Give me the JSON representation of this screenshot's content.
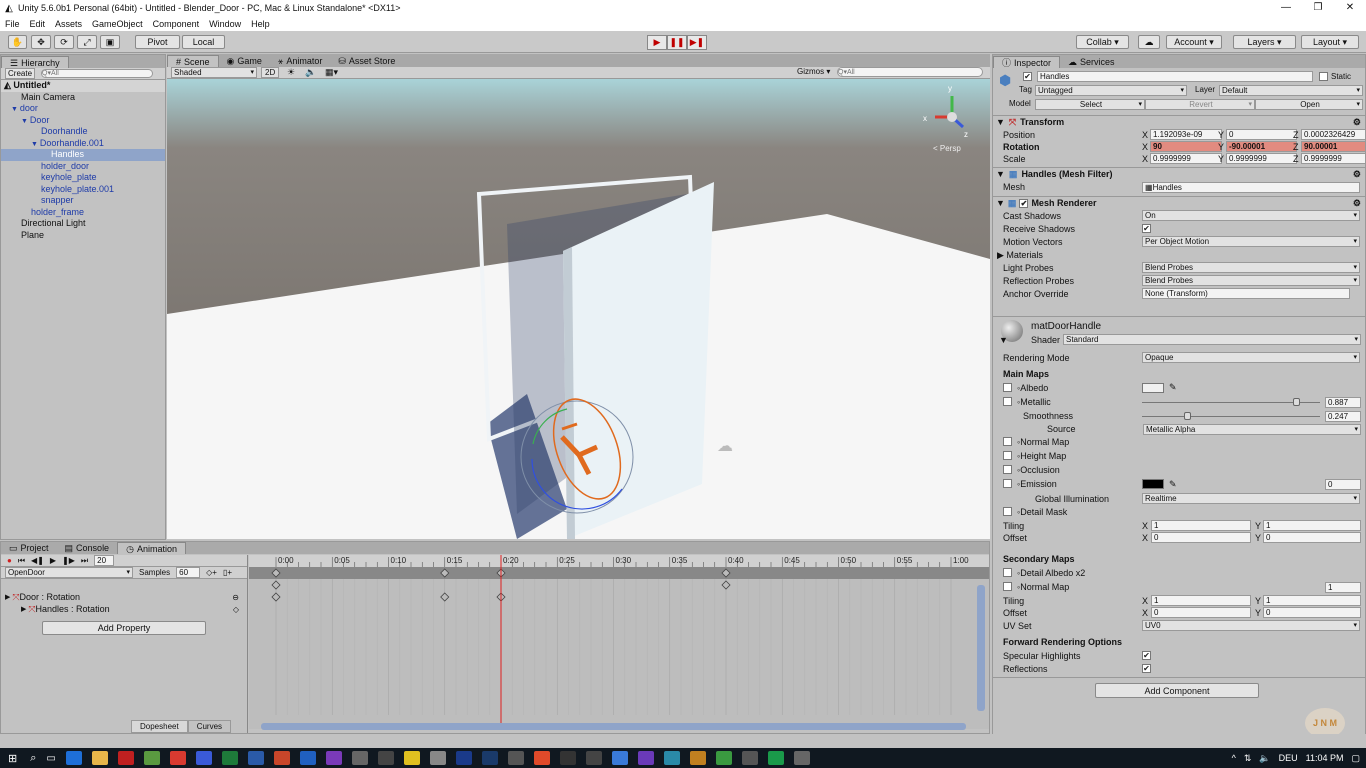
{
  "window": {
    "title": "Unity 5.6.0b1 Personal (64bit) - Untitled - Blender_Door - PC, Mac & Linux Standalone* <DX11>",
    "controls": [
      "—",
      "❐",
      "✕"
    ]
  },
  "menu": [
    "File",
    "Edit",
    "Assets",
    "GameObject",
    "Component",
    "Window",
    "Help"
  ],
  "toolbar": {
    "pivot": "Pivot",
    "local": "Local",
    "collab": "Collab ▾",
    "account": "Account",
    "layers": "Layers",
    "layout": "Layout"
  },
  "hierarchy": {
    "tab": "Hierarchy",
    "create": "Create",
    "search_placeholder": "Q▾All",
    "scene": "Untitled*",
    "items": [
      {
        "label": "Main Camera",
        "indent": 1,
        "blue": false,
        "arrow": ""
      },
      {
        "label": "door",
        "indent": 1,
        "blue": true,
        "arrow": "▼"
      },
      {
        "label": "Door",
        "indent": 2,
        "blue": true,
        "arrow": "▼"
      },
      {
        "label": "Doorhandle",
        "indent": 3,
        "blue": true,
        "arrow": ""
      },
      {
        "label": "Doorhandle.001",
        "indent": 3,
        "blue": true,
        "arrow": "▼"
      },
      {
        "label": "Handles",
        "indent": 4,
        "blue": true,
        "arrow": "",
        "selected": true
      },
      {
        "label": "holder_door",
        "indent": 3,
        "blue": true,
        "arrow": ""
      },
      {
        "label": "keyhole_plate",
        "indent": 3,
        "blue": true,
        "arrow": ""
      },
      {
        "label": "keyhole_plate.001",
        "indent": 3,
        "blue": true,
        "arrow": ""
      },
      {
        "label": "snapper",
        "indent": 3,
        "blue": true,
        "arrow": ""
      },
      {
        "label": "holder_frame",
        "indent": 2,
        "blue": true,
        "arrow": ""
      },
      {
        "label": "Directional Light",
        "indent": 1,
        "blue": false,
        "arrow": ""
      },
      {
        "label": "Plane",
        "indent": 1,
        "blue": false,
        "arrow": ""
      }
    ]
  },
  "scene_tabs": [
    "Scene",
    "Game",
    "Animator",
    "Asset Store"
  ],
  "scene": {
    "shading": "Shaded",
    "two_d": "2D",
    "gizmos": "Gizmos",
    "search_placeholder": "Q▾All",
    "persp": "< Persp"
  },
  "inspector": {
    "tabs": [
      "Inspector",
      "Services"
    ],
    "object_name": "Handles",
    "static": "Static",
    "tag_label": "Tag",
    "tag": "Untagged",
    "layer_label": "Layer",
    "layer": "Default",
    "model_label": "Model",
    "model_buttons": [
      "Select",
      "Revert",
      "Open"
    ],
    "transform": {
      "title": "Transform",
      "position_label": "Position",
      "rotation_label": "Rotation",
      "scale_label": "Scale",
      "position": [
        "1.192093e-09",
        "0",
        "0.0002326429"
      ],
      "rotation": [
        "90",
        "-90.00001",
        "90.00001"
      ],
      "scale": [
        "0.9999999",
        "0.9999999",
        "0.9999999"
      ]
    },
    "mesh_filter": {
      "title": "Handles (Mesh Filter)",
      "mesh_label": "Mesh",
      "mesh": "Handles"
    },
    "mesh_renderer": {
      "title": "Mesh Renderer",
      "rows": [
        {
          "label": "Cast Shadows",
          "value": "On"
        },
        {
          "label": "Receive Shadows",
          "value": "✔"
        },
        {
          "label": "Motion Vectors",
          "value": "Per Object Motion"
        },
        {
          "label": "Materials",
          "value": ""
        },
        {
          "label": "Light Probes",
          "value": "Blend Probes"
        },
        {
          "label": "Reflection Probes",
          "value": "Blend Probes"
        },
        {
          "label": "Anchor Override",
          "value": "None (Transform)"
        }
      ]
    },
    "material": {
      "name": "matDoorHandle",
      "shader_label": "Shader",
      "shader": "Standard",
      "rendering_mode_label": "Rendering Mode",
      "rendering_mode": "Opaque",
      "main_maps": "Main Maps",
      "albedo": "Albedo",
      "metallic": "Metallic",
      "metallic_value": "0.887",
      "metallic_fraction": 0.887,
      "smoothness": "Smoothness",
      "smoothness_value": "0.247",
      "smoothness_fraction": 0.247,
      "source_label": "Source",
      "source": "Metallic Alpha",
      "normal_map": "Normal Map",
      "height_map": "Height Map",
      "occlusion": "Occlusion",
      "emission": "Emission",
      "emission_value": "0",
      "gi_label": "Global Illumination",
      "gi": "Realtime",
      "detail_mask": "Detail Mask",
      "tiling_label": "Tiling",
      "offset_label": "Offset",
      "tiling": [
        "1",
        "1"
      ],
      "offset": [
        "0",
        "0"
      ],
      "secondary_maps": "Secondary Maps",
      "detail_albedo": "Detail Albedo x2",
      "normal_map2": "Normal Map",
      "normal_map2_value": "1",
      "tiling2": [
        "1",
        "1"
      ],
      "offset2": [
        "0",
        "0"
      ],
      "uv_set_label": "UV Set",
      "uv_set": "UV0",
      "forward": "Forward Rendering Options",
      "specular": "Specular Highlights",
      "reflections": "Reflections"
    },
    "add_component": "Add Component"
  },
  "bottom_tabs": [
    "Project",
    "Console",
    "Animation"
  ],
  "animation": {
    "frame": "20",
    "clip": "OpenDoor",
    "samples_label": "Samples",
    "samples": "60",
    "ticks": [
      "0:00",
      "0:05",
      "0:10",
      "0:15",
      "0:20",
      "0:25",
      "0:30",
      "0:35",
      "0:40",
      "0:45",
      "0:50",
      "0:55",
      "1:00"
    ],
    "tracks": [
      {
        "label": "Door : Rotation",
        "keys": [
          0,
          40
        ]
      },
      {
        "label": "Handles : Rotation",
        "keys": [
          0,
          15,
          20
        ]
      }
    ],
    "summary_keys": [
      0,
      15,
      20,
      40
    ],
    "playhead": 20,
    "add_property": "Add Property",
    "dopesheet": "Dopesheet",
    "curves": "Curves"
  },
  "taskbar": {
    "lang": "DEU",
    "time": "11:04 PM"
  }
}
